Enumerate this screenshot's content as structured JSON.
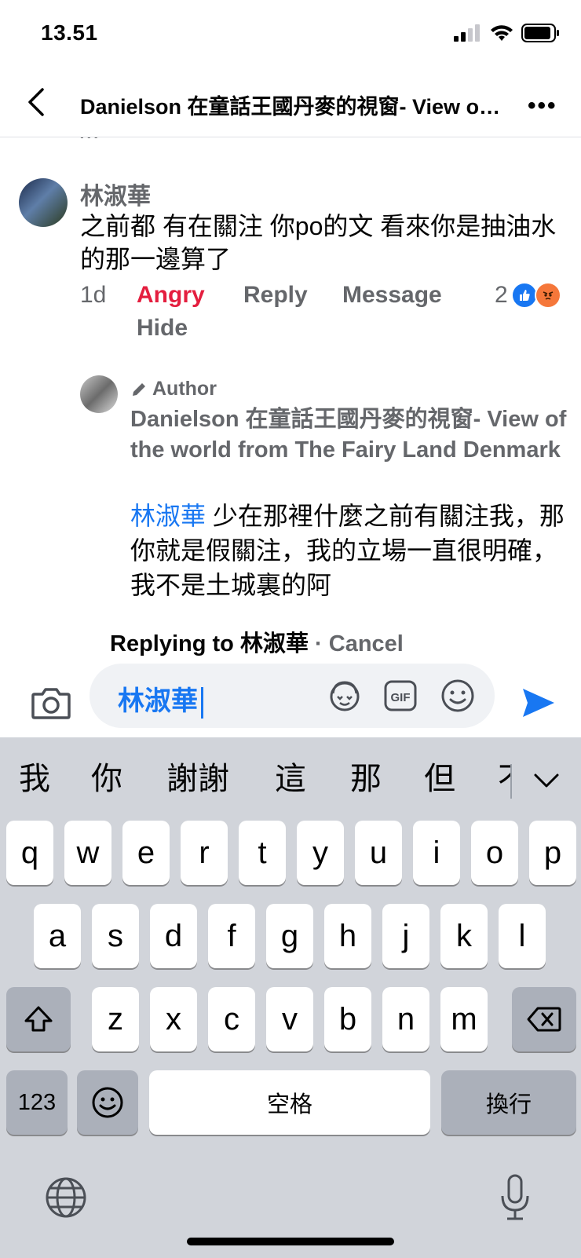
{
  "status": {
    "time": "13.51"
  },
  "header": {
    "title": "Danielson 在童話王國丹麥的視窗- View of the world from The Fairy Land Denmark"
  },
  "comments": {
    "cut_text": "...",
    "c1": {
      "name": "林淑華",
      "text": "之前都 有在關注 你po的文 看來你是抽油水的那一邊算了",
      "time": "1d",
      "reaction": "Angry",
      "reply": "Reply",
      "message": "Message",
      "hide": "Hide",
      "reaction_count": "2"
    },
    "c2": {
      "badge": "Author",
      "name": "Danielson 在童話王國丹麥的視窗- View of the world from The Fairy Land Denmark",
      "mention": "林淑華",
      "text": " 少在那裡什麼之前有關注我，那你就是假關注，我的立場一直很明確，我不是土城裏的阿"
    }
  },
  "composer": {
    "replying_prefix": "Replying to ",
    "replying_name": "林淑華",
    "separator": " · ",
    "cancel": "Cancel",
    "input_value": "林淑華"
  },
  "keyboard": {
    "suggestions": [
      "我",
      "你",
      "謝謝",
      "這",
      "那",
      "但",
      "不"
    ],
    "row1": [
      "q",
      "w",
      "e",
      "r",
      "t",
      "y",
      "u",
      "i",
      "o",
      "p"
    ],
    "row2": [
      "a",
      "s",
      "d",
      "f",
      "g",
      "h",
      "j",
      "k",
      "l"
    ],
    "row3": [
      "z",
      "x",
      "c",
      "v",
      "b",
      "n",
      "m"
    ],
    "numbers_key": "123",
    "space_key": "空格",
    "return_key": "換行"
  },
  "colors": {
    "accent": "#1877f2",
    "angry": "#e41e3f",
    "secondary": "#65676b"
  }
}
